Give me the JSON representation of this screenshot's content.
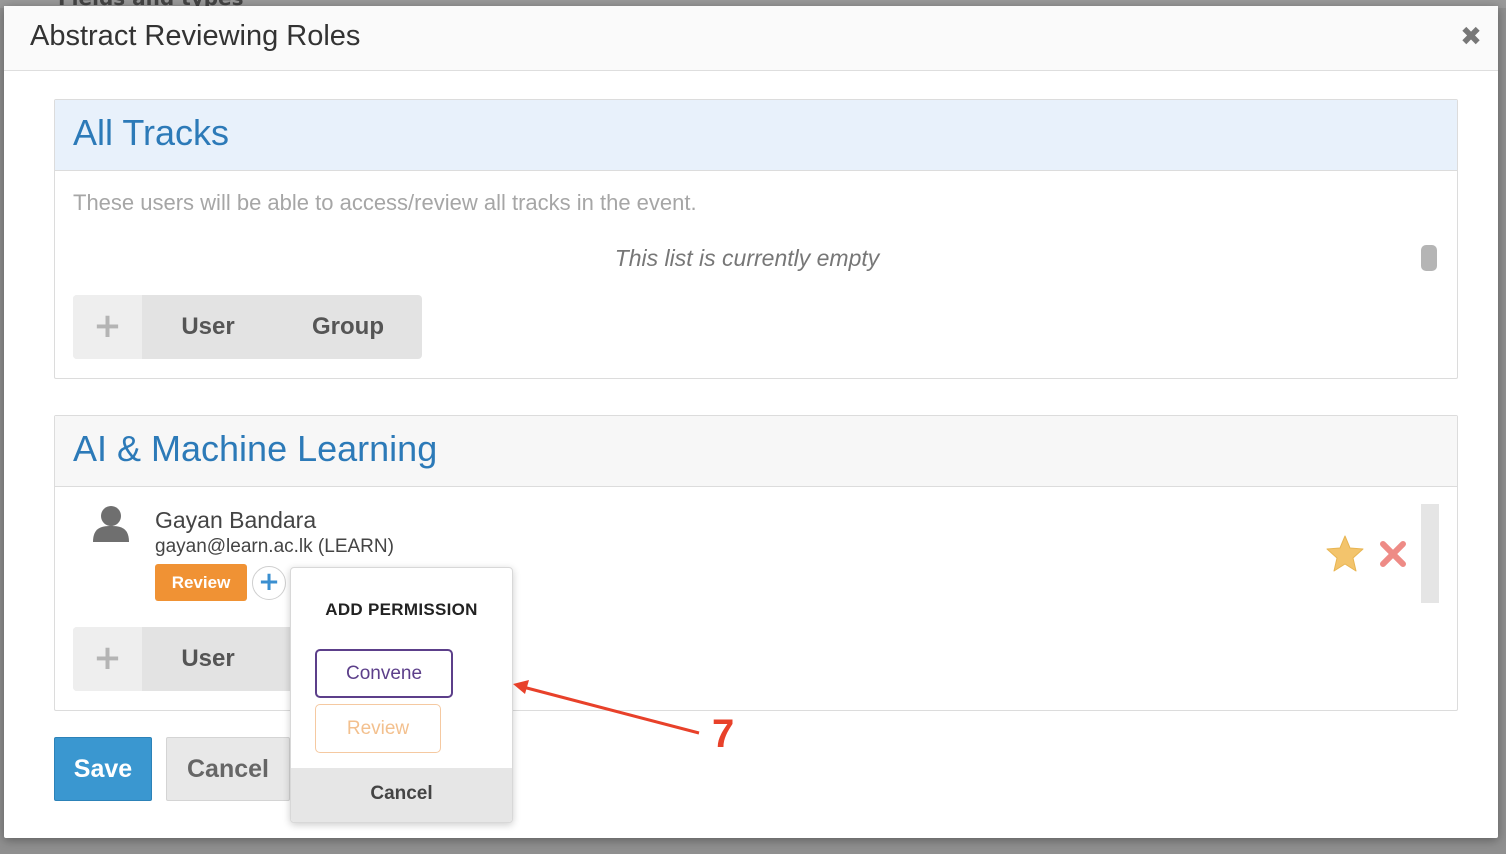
{
  "background": {
    "partial_text": "Fields and types"
  },
  "dialog": {
    "title": "Abstract Reviewing Roles",
    "close_icon": "close-icon"
  },
  "all_tracks": {
    "title": "All Tracks",
    "description": "These users will be able to access/review all tracks in the event.",
    "empty_message": "This list is currently empty",
    "add_buttons": {
      "plus": "+",
      "user": "User",
      "group": "Group"
    }
  },
  "track": {
    "title": "AI & Machine Learning",
    "users": [
      {
        "name": "Gayan Bandara",
        "email": "gayan@learn.ac.lk (LEARN)",
        "badge": "Review",
        "add_permission": "+"
      }
    ],
    "add_buttons": {
      "plus": "+",
      "user": "User"
    }
  },
  "footer": {
    "save": "Save",
    "cancel": "Cancel"
  },
  "popup": {
    "title": "ADD PERMISSION",
    "options": [
      "Convene",
      "Review"
    ],
    "cancel": "Cancel"
  },
  "annotation": {
    "number": "7"
  },
  "colors": {
    "accent_blue": "#3a97d0",
    "title_blue": "#2c7ab8",
    "review_orange": "#f09234",
    "convene_purple": "#5c3f8a",
    "annotation_red": "#e8412a",
    "star_gold": "#f3c46c",
    "remove_red": "#ee8b86"
  }
}
